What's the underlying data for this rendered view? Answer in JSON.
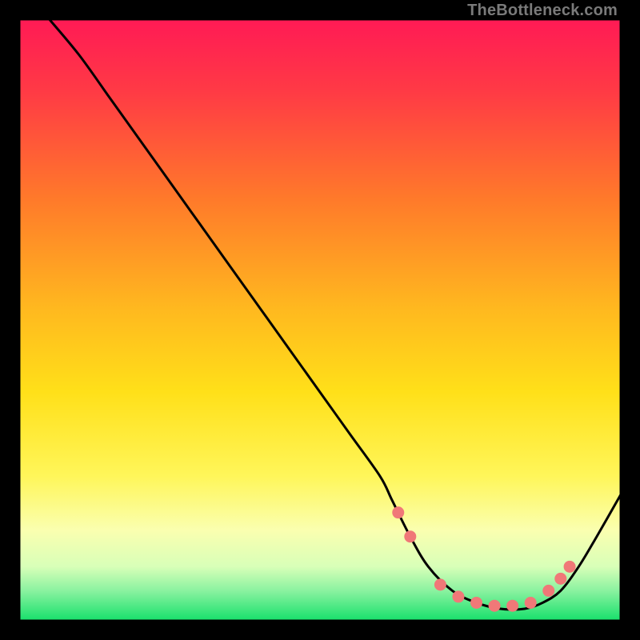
{
  "watermark": "TheBottleneck.com",
  "colors": {
    "bg": "#000000",
    "gradient_top": "#ff1a4d",
    "gradient_mid_upper": "#ff8a1a",
    "gradient_mid": "#ffe019",
    "gradient_mid_lower": "#fbffa0",
    "gradient_bottom": "#16e06b",
    "curve": "#000000",
    "dots": "#f07878"
  },
  "chart_data": {
    "type": "line",
    "title": "",
    "xlabel": "",
    "ylabel": "",
    "xlim": [
      0,
      100
    ],
    "ylim": [
      0,
      100
    ],
    "series": [
      {
        "name": "bottleneck-curve",
        "x": [
          5,
          10,
          15,
          20,
          25,
          30,
          35,
          40,
          45,
          50,
          55,
          60,
          62,
          65,
          68,
          72,
          76,
          80,
          84,
          87,
          90,
          93,
          96,
          100
        ],
        "y": [
          100,
          94,
          87,
          80,
          73,
          66,
          59,
          52,
          45,
          38,
          31,
          24,
          20,
          14,
          9,
          5,
          3,
          2,
          2,
          3,
          5,
          9,
          14,
          21
        ]
      }
    ],
    "dots": {
      "name": "highlight-dots",
      "points": [
        {
          "x": 63,
          "y": 18
        },
        {
          "x": 65,
          "y": 14
        },
        {
          "x": 70,
          "y": 6
        },
        {
          "x": 73,
          "y": 4
        },
        {
          "x": 76,
          "y": 3
        },
        {
          "x": 79,
          "y": 2.5
        },
        {
          "x": 82,
          "y": 2.5
        },
        {
          "x": 85,
          "y": 3
        },
        {
          "x": 88,
          "y": 5
        },
        {
          "x": 90,
          "y": 7
        },
        {
          "x": 91.5,
          "y": 9
        }
      ]
    }
  }
}
